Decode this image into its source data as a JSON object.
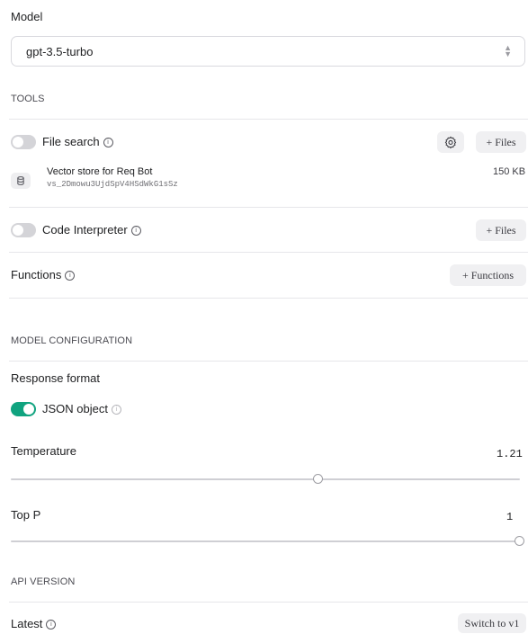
{
  "model": {
    "label": "Model",
    "selected": "gpt-3.5-turbo"
  },
  "tools": {
    "section_label": "TOOLS",
    "file_search": {
      "label": "File search",
      "enabled": false,
      "files_button": "+ Files",
      "vector_store": {
        "name": "Vector store for Req Bot",
        "id": "vs_2Dmowu3UjdSpV4HSdWkG1sSz",
        "size": "150 KB"
      }
    },
    "code_interpreter": {
      "label": "Code Interpreter",
      "enabled": false,
      "files_button": "+ Files"
    },
    "functions": {
      "label": "Functions",
      "button": "+ Functions"
    }
  },
  "model_configuration": {
    "section_label": "MODEL CONFIGURATION",
    "response_format": {
      "label": "Response format",
      "json_object_label": "JSON object",
      "json_object_enabled": true
    },
    "temperature": {
      "label": "Temperature",
      "value": "1.21",
      "fraction": 0.605
    },
    "top_p": {
      "label": "Top P",
      "value": "1",
      "fraction": 1.0
    }
  },
  "api_version": {
    "section_label": "API VERSION",
    "label": "Latest",
    "switch_button": "Switch to v1"
  },
  "colors": {
    "accent": "#10a37f",
    "toggle_off": "#d4d4d8",
    "button_bg": "#f0f0f2",
    "divider": "#e6e6ea"
  }
}
